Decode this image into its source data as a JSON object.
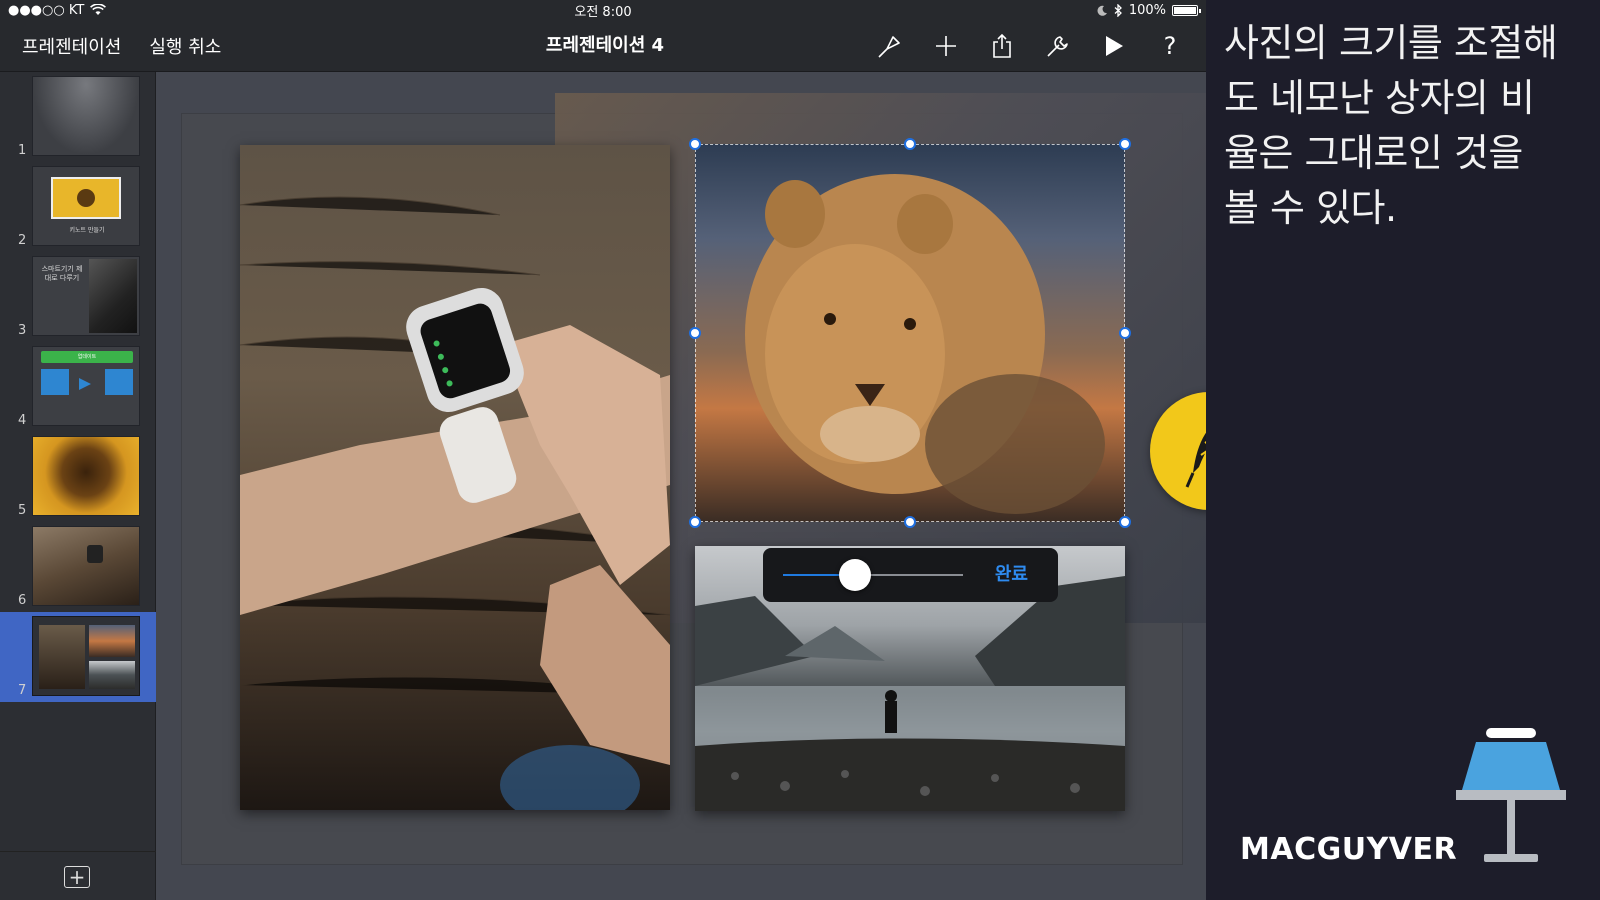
{
  "status_bar": {
    "carrier": "●●●○○ KT",
    "time": "오전 8:00",
    "battery": "100%",
    "battery_level": 1.0
  },
  "toolbar": {
    "presentations_label": "프레젠테이션",
    "undo_label": "실행 취소",
    "document_title": "프레젠테이션 4",
    "icons": [
      "brush-icon",
      "plus-icon",
      "share-icon",
      "wrench-icon",
      "play-icon",
      "help-icon"
    ],
    "help_glyph": "?"
  },
  "navigator": {
    "slides": [
      {
        "number": "1"
      },
      {
        "number": "2",
        "caption": "키노트 만들기"
      },
      {
        "number": "3",
        "caption": "스마트기기 제대로 다루기"
      },
      {
        "number": "4",
        "caption": "업데이트"
      },
      {
        "number": "5"
      },
      {
        "number": "6"
      },
      {
        "number": "7",
        "selected": true
      }
    ],
    "add_glyph": "+"
  },
  "editor": {
    "scale_slider_value": 0.4,
    "done_label": "완료",
    "accent": "#1f6fe0"
  },
  "panel": {
    "caption_line1": "사진의 크기를 조절해",
    "caption_line2": "도 네모난 상자의 비",
    "caption_line3": "율은 그대로인 것을",
    "caption_line4": "볼 수 있다.",
    "brand": "MACGUYVER",
    "badge_color": "#f2c81a"
  }
}
